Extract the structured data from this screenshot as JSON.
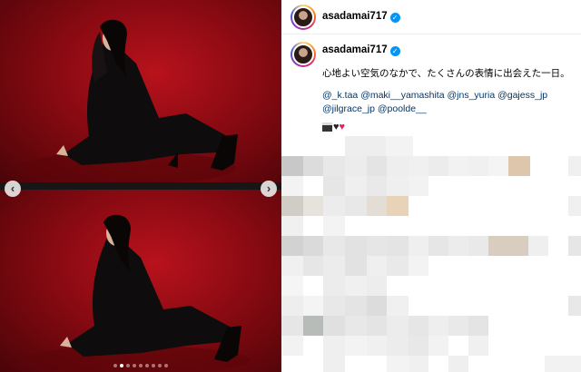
{
  "account": {
    "username": "asadamai717",
    "verified_mark": "✓"
  },
  "post": {
    "caption": "心地よい空気のなかで、たくさんの表情に出会えた一日。",
    "mentions": [
      "@_k.taa",
      "@maki__yamashita",
      "@jns_yuria",
      "@gajess_jp",
      "@jilgrace_jp",
      "@poolde__"
    ],
    "emoji_icons": [
      "clapper-board-icon",
      "black-heart-icon",
      "red-heart-icon"
    ]
  },
  "carousel": {
    "prev_glyph": "‹",
    "next_glyph": "›",
    "slide_count": 9,
    "active_slide": 2
  },
  "colors": {
    "verified": "#0095f6",
    "mention": "#4a6ea9",
    "backdrop_red": "#8a0a12"
  }
}
